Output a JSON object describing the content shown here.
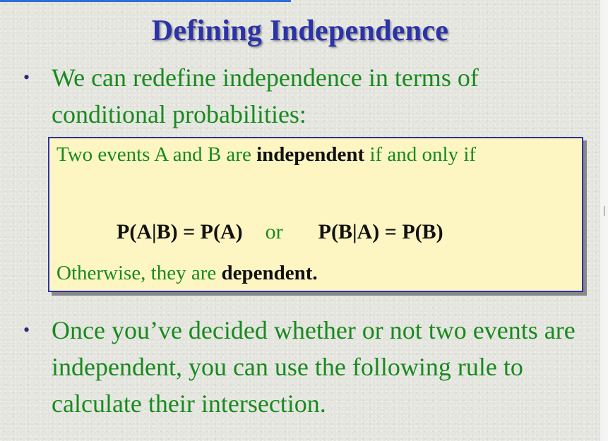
{
  "slide": {
    "title": "Defining Independence",
    "bullets": [
      {
        "marker": "•",
        "text": "We can redefine independence in terms of conditional probabilities:"
      },
      {
        "marker": "•",
        "text": "Once you’ve decided whether or not two events are independent, you can use the following rule to calculate their intersection."
      }
    ],
    "definition_box": {
      "line1_pre": "Two events A and B are ",
      "line1_bold": "independent",
      "line1_post": " if and only if",
      "formula_left": "P(A|B) = P(A)",
      "formula_or": "or",
      "formula_right": "P(B|A) = P(B)",
      "otherwise_pre": "Otherwise, they are ",
      "otherwise_bold": "dependent."
    }
  },
  "colors": {
    "title": "#2b33a8",
    "body_text": "#188a1e",
    "box_fill": "#fdf5c2",
    "box_border": "#2b33a8",
    "emphasis": "#111111"
  }
}
